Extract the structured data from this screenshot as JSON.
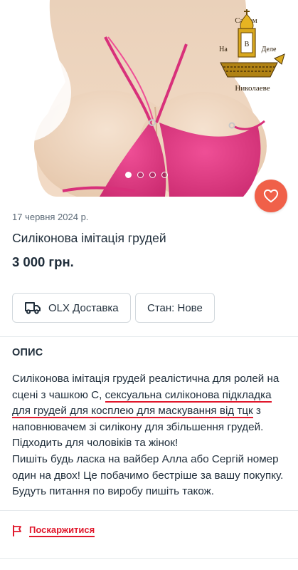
{
  "hero": {
    "icons": {
      "back": "chevron-left-icon",
      "share": "share-icon",
      "favorite": "heart-icon"
    },
    "gallery": {
      "total": 4,
      "active": 1
    },
    "watermark": {
      "line1": "Самом",
      "line2_left": "На",
      "line2_right": "Деле",
      "letter": "В",
      "line3": "Николаеве"
    }
  },
  "listing": {
    "date": "17 червня 2024 р.",
    "title": "Силіконова імітація грудей",
    "price": "3 000 грн."
  },
  "chips": {
    "delivery": "OLX Доставка",
    "condition": "Стан: Нове"
  },
  "description": {
    "heading": "ОПИС",
    "p1_before": "Силіконова імітація грудей реалістична для ролей на сцені з чашкою С, ",
    "p1_underlined": "сексуальна силіконова підкладка для грудей для косплею для маскування від тцк",
    "p1_after": " з наповнювачем зі силікону для збільшення грудей.",
    "line2": "Підходить для чоловіків та жінок!",
    "line3": "Пишіть будь ласка на вайбер Алла або Сергій номер один на двох! Це побачимо бестріше за вашу покупку.",
    "line4": "Будуть питання по виробу пишіть також."
  },
  "report": {
    "label": "Поскаржитися",
    "icon": "flag-icon"
  },
  "colors": {
    "accent": "#f06049",
    "report_red": "#e0182c",
    "text": "#1f2d3a",
    "muted": "#5d6b78",
    "bikini": "#e63a86",
    "skin": "#efd5bc"
  }
}
